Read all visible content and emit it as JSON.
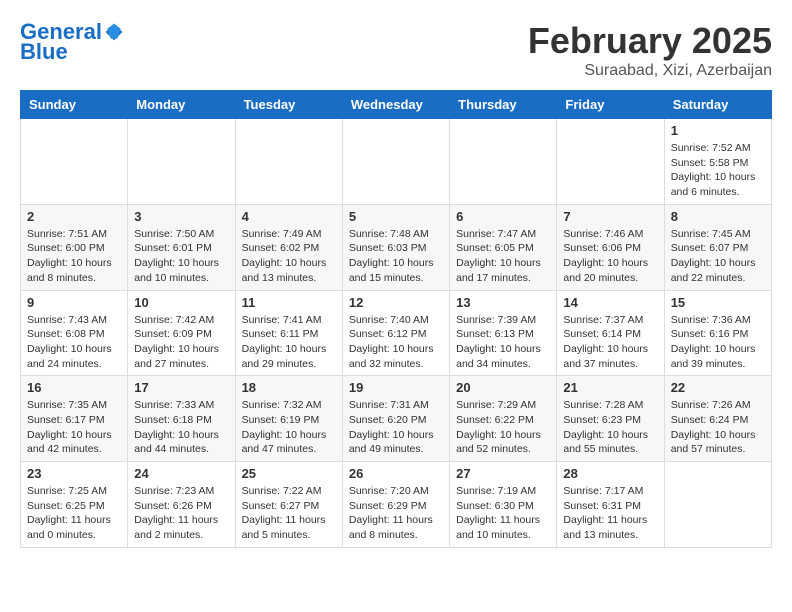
{
  "header": {
    "logo_line1": "General",
    "logo_line2": "Blue",
    "month_title": "February 2025",
    "subtitle": "Suraabad, Xizi, Azerbaijan"
  },
  "days_of_week": [
    "Sunday",
    "Monday",
    "Tuesday",
    "Wednesday",
    "Thursday",
    "Friday",
    "Saturday"
  ],
  "weeks": [
    [
      {
        "day": "",
        "info": ""
      },
      {
        "day": "",
        "info": ""
      },
      {
        "day": "",
        "info": ""
      },
      {
        "day": "",
        "info": ""
      },
      {
        "day": "",
        "info": ""
      },
      {
        "day": "",
        "info": ""
      },
      {
        "day": "1",
        "info": "Sunrise: 7:52 AM\nSunset: 5:58 PM\nDaylight: 10 hours and 6 minutes."
      }
    ],
    [
      {
        "day": "2",
        "info": "Sunrise: 7:51 AM\nSunset: 6:00 PM\nDaylight: 10 hours and 8 minutes."
      },
      {
        "day": "3",
        "info": "Sunrise: 7:50 AM\nSunset: 6:01 PM\nDaylight: 10 hours and 10 minutes."
      },
      {
        "day": "4",
        "info": "Sunrise: 7:49 AM\nSunset: 6:02 PM\nDaylight: 10 hours and 13 minutes."
      },
      {
        "day": "5",
        "info": "Sunrise: 7:48 AM\nSunset: 6:03 PM\nDaylight: 10 hours and 15 minutes."
      },
      {
        "day": "6",
        "info": "Sunrise: 7:47 AM\nSunset: 6:05 PM\nDaylight: 10 hours and 17 minutes."
      },
      {
        "day": "7",
        "info": "Sunrise: 7:46 AM\nSunset: 6:06 PM\nDaylight: 10 hours and 20 minutes."
      },
      {
        "day": "8",
        "info": "Sunrise: 7:45 AM\nSunset: 6:07 PM\nDaylight: 10 hours and 22 minutes."
      }
    ],
    [
      {
        "day": "9",
        "info": "Sunrise: 7:43 AM\nSunset: 6:08 PM\nDaylight: 10 hours and 24 minutes."
      },
      {
        "day": "10",
        "info": "Sunrise: 7:42 AM\nSunset: 6:09 PM\nDaylight: 10 hours and 27 minutes."
      },
      {
        "day": "11",
        "info": "Sunrise: 7:41 AM\nSunset: 6:11 PM\nDaylight: 10 hours and 29 minutes."
      },
      {
        "day": "12",
        "info": "Sunrise: 7:40 AM\nSunset: 6:12 PM\nDaylight: 10 hours and 32 minutes."
      },
      {
        "day": "13",
        "info": "Sunrise: 7:39 AM\nSunset: 6:13 PM\nDaylight: 10 hours and 34 minutes."
      },
      {
        "day": "14",
        "info": "Sunrise: 7:37 AM\nSunset: 6:14 PM\nDaylight: 10 hours and 37 minutes."
      },
      {
        "day": "15",
        "info": "Sunrise: 7:36 AM\nSunset: 6:16 PM\nDaylight: 10 hours and 39 minutes."
      }
    ],
    [
      {
        "day": "16",
        "info": "Sunrise: 7:35 AM\nSunset: 6:17 PM\nDaylight: 10 hours and 42 minutes."
      },
      {
        "day": "17",
        "info": "Sunrise: 7:33 AM\nSunset: 6:18 PM\nDaylight: 10 hours and 44 minutes."
      },
      {
        "day": "18",
        "info": "Sunrise: 7:32 AM\nSunset: 6:19 PM\nDaylight: 10 hours and 47 minutes."
      },
      {
        "day": "19",
        "info": "Sunrise: 7:31 AM\nSunset: 6:20 PM\nDaylight: 10 hours and 49 minutes."
      },
      {
        "day": "20",
        "info": "Sunrise: 7:29 AM\nSunset: 6:22 PM\nDaylight: 10 hours and 52 minutes."
      },
      {
        "day": "21",
        "info": "Sunrise: 7:28 AM\nSunset: 6:23 PM\nDaylight: 10 hours and 55 minutes."
      },
      {
        "day": "22",
        "info": "Sunrise: 7:26 AM\nSunset: 6:24 PM\nDaylight: 10 hours and 57 minutes."
      }
    ],
    [
      {
        "day": "23",
        "info": "Sunrise: 7:25 AM\nSunset: 6:25 PM\nDaylight: 11 hours and 0 minutes."
      },
      {
        "day": "24",
        "info": "Sunrise: 7:23 AM\nSunset: 6:26 PM\nDaylight: 11 hours and 2 minutes."
      },
      {
        "day": "25",
        "info": "Sunrise: 7:22 AM\nSunset: 6:27 PM\nDaylight: 11 hours and 5 minutes."
      },
      {
        "day": "26",
        "info": "Sunrise: 7:20 AM\nSunset: 6:29 PM\nDaylight: 11 hours and 8 minutes."
      },
      {
        "day": "27",
        "info": "Sunrise: 7:19 AM\nSunset: 6:30 PM\nDaylight: 11 hours and 10 minutes."
      },
      {
        "day": "28",
        "info": "Sunrise: 7:17 AM\nSunset: 6:31 PM\nDaylight: 11 hours and 13 minutes."
      },
      {
        "day": "",
        "info": ""
      }
    ]
  ]
}
